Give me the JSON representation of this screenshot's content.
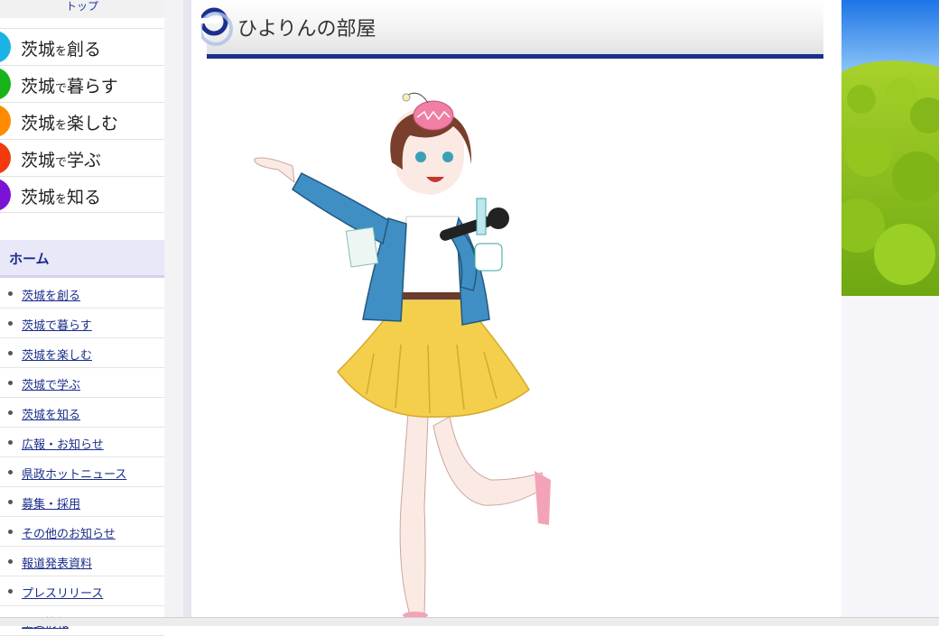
{
  "sidebar": {
    "top_tab": "トップ",
    "categories": [
      {
        "pre": "茨城",
        "mid": "を",
        "post": "創る",
        "color": "#1ab3e8"
      },
      {
        "pre": "茨城",
        "mid": "で",
        "post": "暮らす",
        "color": "#18b318"
      },
      {
        "pre": "茨城",
        "mid": "を",
        "post": "楽しむ",
        "color": "#ff8c00"
      },
      {
        "pre": "茨城",
        "mid": "で",
        "post": "学ぶ",
        "color": "#f23a0c"
      },
      {
        "pre": "茨城",
        "mid": "を",
        "post": "知る",
        "color": "#7b12d6"
      }
    ],
    "home_heading": "ホーム",
    "links": [
      "茨城を創る",
      "茨城で暮らす",
      "茨城を楽しむ",
      "茨城で学ぶ",
      "茨城を知る",
      "広報・お知らせ",
      "県政ホットニュース",
      "募集・採用",
      "その他のお知らせ",
      "報道発表資料",
      "プレスリリース",
      "重要情報"
    ]
  },
  "main": {
    "title": "ひよりんの部屋"
  },
  "colors": {
    "accent": "#1b2f8d",
    "link": "#1a2d8a"
  }
}
